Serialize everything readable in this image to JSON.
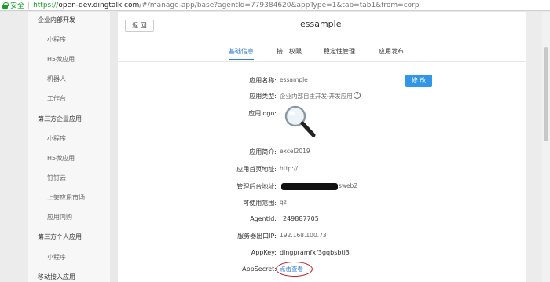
{
  "browser": {
    "secure_label": "安全",
    "url_scheme": "https://",
    "url_host": "open-dev.dingtalk.com",
    "url_rest": "/#/manage-app/base?agentId=779384620&appType=1&tab=tab1&from=corp"
  },
  "sidebar": {
    "items": [
      {
        "label": "企业内部开发",
        "type": "group"
      },
      {
        "label": "小程序",
        "type": "sub"
      },
      {
        "label": "H5微应用",
        "type": "sub"
      },
      {
        "label": "机器人",
        "type": "sub"
      },
      {
        "label": "工作台",
        "type": "sub"
      },
      {
        "label": "第三方企业应用",
        "type": "group"
      },
      {
        "label": "小程序",
        "type": "sub"
      },
      {
        "label": "H5微应用",
        "type": "sub"
      },
      {
        "label": "钉钉云",
        "type": "sub"
      },
      {
        "label": "上架应用市场",
        "type": "sub"
      },
      {
        "label": "应用内购",
        "type": "sub"
      },
      {
        "label": "第三方个人应用",
        "type": "group"
      },
      {
        "label": "小程序",
        "type": "sub"
      },
      {
        "label": "移动接入应用",
        "type": "group"
      }
    ]
  },
  "header": {
    "back_label": "返 回",
    "title": "essample"
  },
  "tabs": [
    {
      "label": "基础信息",
      "active": true
    },
    {
      "label": "接口权限",
      "active": false
    },
    {
      "label": "稳定性管理",
      "active": false
    },
    {
      "label": "应用发布",
      "active": false
    }
  ],
  "fields": {
    "name": {
      "label": "应用名称:",
      "value": "essample"
    },
    "type": {
      "label": "应用类型:",
      "value": "企业内部自主开发-开发应用"
    },
    "logo": {
      "label": "应用logo:",
      "icon": "magnifier-icon"
    },
    "intro": {
      "label": "应用简介:",
      "value": "excel2019"
    },
    "homepage": {
      "label": "应用首页地址:",
      "value": "http://"
    },
    "admin": {
      "label": "管理后台地址:",
      "value_tail": "sweb2"
    },
    "scope": {
      "label": "可使用范围:",
      "value": "qz"
    },
    "agentid": {
      "label": "AgentId:",
      "value": "249887705"
    },
    "ip": {
      "label": "服务器出口IP:",
      "value": "192.168.100.73"
    },
    "appkey": {
      "label": "AppKey:",
      "value": "dingpramfxf3gqbsbti3"
    },
    "appsecret": {
      "label": "AppSecret:",
      "value": "点击查看"
    }
  },
  "edit_label": "修 改",
  "help_glyph": "?",
  "colors": {
    "accent": "#2d7dd7",
    "button": "#3296e8",
    "annotation": "#c0181e"
  }
}
